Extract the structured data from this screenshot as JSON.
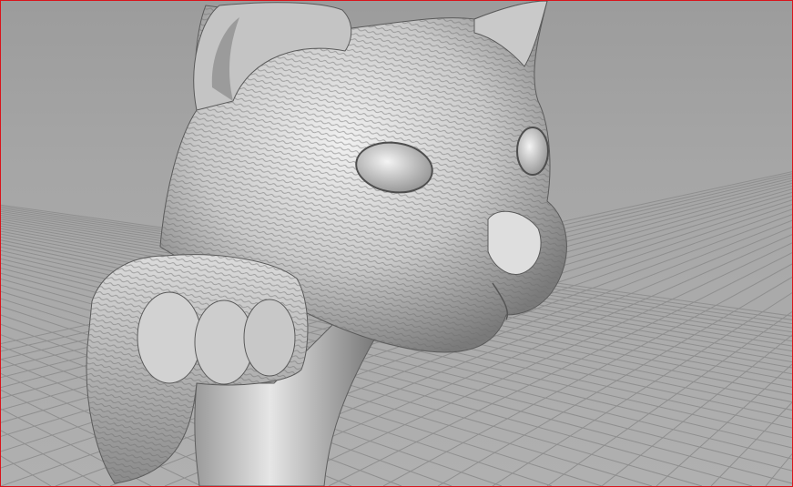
{
  "viewport": {
    "view": "perspective",
    "display_mode": "rendered",
    "border_color": "#d9141b",
    "background_color": "#a6a6a6",
    "grid_color": "#8f8f8f",
    "model_color": "#d7d7d7",
    "model": "cat-head-sculpture-mesh",
    "grid": true
  }
}
